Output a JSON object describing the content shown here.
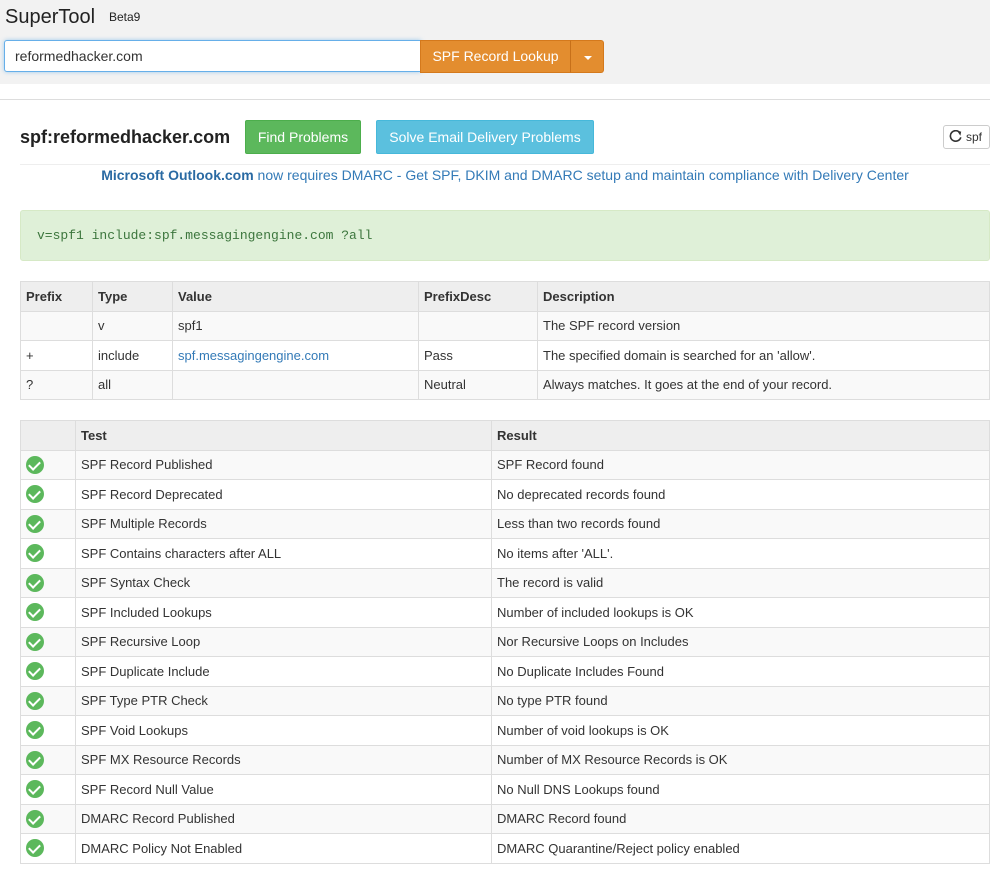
{
  "header": {
    "brand": "SuperTool",
    "beta": "Beta9",
    "search_value": "reformedhacker.com",
    "lookup_button": "SPF Record Lookup"
  },
  "panel": {
    "title": "spf:reformedhacker.com",
    "find_button": "Find Problems",
    "solve_button": "Solve Email Delivery Problems",
    "refresh_label": "spf",
    "notice_strong": "Microsoft Outlook.com",
    "notice_rest": " now requires DMARC - Get SPF, DKIM and DMARC setup and maintain compliance with Delivery Center",
    "record": "v=spf1 include:spf.messagingengine.com ?all"
  },
  "record_table": {
    "headers": [
      "Prefix",
      "Type",
      "Value",
      "PrefixDesc",
      "Description"
    ],
    "rows": [
      [
        "",
        "v",
        "spf1",
        "",
        "The SPF record version"
      ],
      [
        "+",
        "include",
        "spf.messagingengine.com",
        "Pass",
        "The specified domain is searched for an 'allow'."
      ],
      [
        "?",
        "all",
        "",
        "Neutral",
        "Always matches. It goes at the end of your record."
      ]
    ]
  },
  "test_table": {
    "headers": [
      "",
      "Test",
      "Result"
    ],
    "rows": [
      [
        "SPF Record Published",
        "SPF Record found"
      ],
      [
        "SPF Record Deprecated",
        "No deprecated records found"
      ],
      [
        "SPF Multiple Records",
        "Less than two records found"
      ],
      [
        "SPF Contains characters after ALL",
        "No items after 'ALL'."
      ],
      [
        "SPF Syntax Check",
        "The record is valid"
      ],
      [
        "SPF Included Lookups",
        "Number of included lookups is OK"
      ],
      [
        "SPF Recursive Loop",
        "Nor Recursive Loops on Includes"
      ],
      [
        "SPF Duplicate Include",
        "No Duplicate Includes Found"
      ],
      [
        "SPF Type PTR Check",
        "No type PTR found"
      ],
      [
        "SPF Void Lookups",
        "Number of void lookups is OK"
      ],
      [
        "SPF MX Resource Records",
        "Number of MX Resource Records is OK"
      ],
      [
        "SPF Record Null Value",
        "No Null DNS Lookups found"
      ],
      [
        "DMARC Record Published",
        "DMARC Record found"
      ],
      [
        "DMARC Policy Not Enabled",
        "DMARC Quarantine/Reject policy enabled"
      ]
    ]
  }
}
